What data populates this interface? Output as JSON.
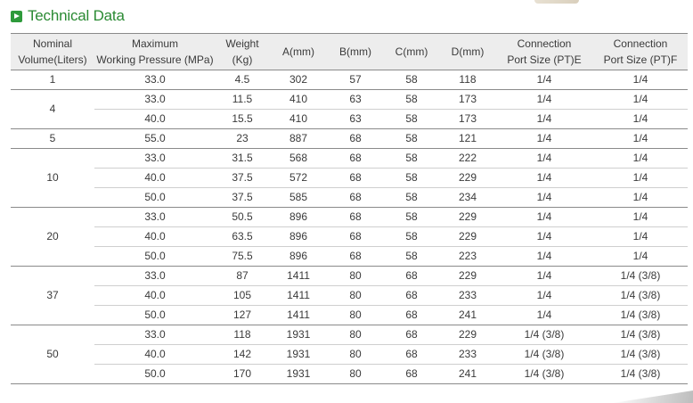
{
  "section_title": "Technical Data",
  "table": {
    "headers": {
      "volume_line1": "Nominal",
      "volume_line2": "Volume(Liters)",
      "pressure_line1": "Maximum",
      "pressure_line2": "Working Pressure (MPa)",
      "weight_line1": "Weight",
      "weight_line2": "(Kg)",
      "a": "A(mm)",
      "b": "B(mm)",
      "c": "C(mm)",
      "d": "D(mm)",
      "port_e_line1": "Connection",
      "port_e_line2": "Port Size (PT)E",
      "port_f_line1": "Connection",
      "port_f_line2": "Port Size (PT)F"
    },
    "groups": [
      {
        "volume": "1",
        "rows": [
          {
            "pressure": "33.0",
            "weight": "4.5",
            "a": "302",
            "b": "57",
            "c": "58",
            "d": "118",
            "port_e": "1/4",
            "port_f": "1/4"
          }
        ]
      },
      {
        "volume": "4",
        "rows": [
          {
            "pressure": "33.0",
            "weight": "11.5",
            "a": "410",
            "b": "63",
            "c": "58",
            "d": "173",
            "port_e": "1/4",
            "port_f": "1/4"
          },
          {
            "pressure": "40.0",
            "weight": "15.5",
            "a": "410",
            "b": "63",
            "c": "58",
            "d": "173",
            "port_e": "1/4",
            "port_f": "1/4"
          }
        ]
      },
      {
        "volume": "5",
        "rows": [
          {
            "pressure": "55.0",
            "weight": "23",
            "a": "887",
            "b": "68",
            "c": "58",
            "d": "121",
            "port_e": "1/4",
            "port_f": "1/4"
          }
        ]
      },
      {
        "volume": "10",
        "rows": [
          {
            "pressure": "33.0",
            "weight": "31.5",
            "a": "568",
            "b": "68",
            "c": "58",
            "d": "222",
            "port_e": "1/4",
            "port_f": "1/4"
          },
          {
            "pressure": "40.0",
            "weight": "37.5",
            "a": "572",
            "b": "68",
            "c": "58",
            "d": "229",
            "port_e": "1/4",
            "port_f": "1/4"
          },
          {
            "pressure": "50.0",
            "weight": "37.5",
            "a": "585",
            "b": "68",
            "c": "58",
            "d": "234",
            "port_e": "1/4",
            "port_f": "1/4"
          }
        ]
      },
      {
        "volume": "20",
        "rows": [
          {
            "pressure": "33.0",
            "weight": "50.5",
            "a": "896",
            "b": "68",
            "c": "58",
            "d": "229",
            "port_e": "1/4",
            "port_f": "1/4"
          },
          {
            "pressure": "40.0",
            "weight": "63.5",
            "a": "896",
            "b": "68",
            "c": "58",
            "d": "229",
            "port_e": "1/4",
            "port_f": "1/4"
          },
          {
            "pressure": "50.0",
            "weight": "75.5",
            "a": "896",
            "b": "68",
            "c": "58",
            "d": "223",
            "port_e": "1/4",
            "port_f": "1/4"
          }
        ]
      },
      {
        "volume": "37",
        "rows": [
          {
            "pressure": "33.0",
            "weight": "87",
            "a": "1411",
            "b": "80",
            "c": "68",
            "d": "229",
            "port_e": "1/4",
            "port_f": "1/4 (3/8)"
          },
          {
            "pressure": "40.0",
            "weight": "105",
            "a": "1411",
            "b": "80",
            "c": "68",
            "d": "233",
            "port_e": "1/4",
            "port_f": "1/4 (3/8)"
          },
          {
            "pressure": "50.0",
            "weight": "127",
            "a": "1411",
            "b": "80",
            "c": "68",
            "d": "241",
            "port_e": "1/4",
            "port_f": "1/4 (3/8)"
          }
        ]
      },
      {
        "volume": "50",
        "rows": [
          {
            "pressure": "33.0",
            "weight": "118",
            "a": "1931",
            "b": "80",
            "c": "68",
            "d": "229",
            "port_e": "1/4 (3/8)",
            "port_f": "1/4 (3/8)"
          },
          {
            "pressure": "40.0",
            "weight": "142",
            "a": "1931",
            "b": "80",
            "c": "68",
            "d": "233",
            "port_e": "1/4 (3/8)",
            "port_f": "1/4 (3/8)"
          },
          {
            "pressure": "50.0",
            "weight": "170",
            "a": "1931",
            "b": "80",
            "c": "68",
            "d": "241",
            "port_e": "1/4 (3/8)",
            "port_f": "1/4 (3/8)"
          }
        ]
      }
    ]
  },
  "colors": {
    "accent_green": "#2a8a33",
    "icon_green": "#2e9a3b",
    "header_bg": "#ededed"
  },
  "icons": {
    "section_icon": "play-square-icon"
  }
}
